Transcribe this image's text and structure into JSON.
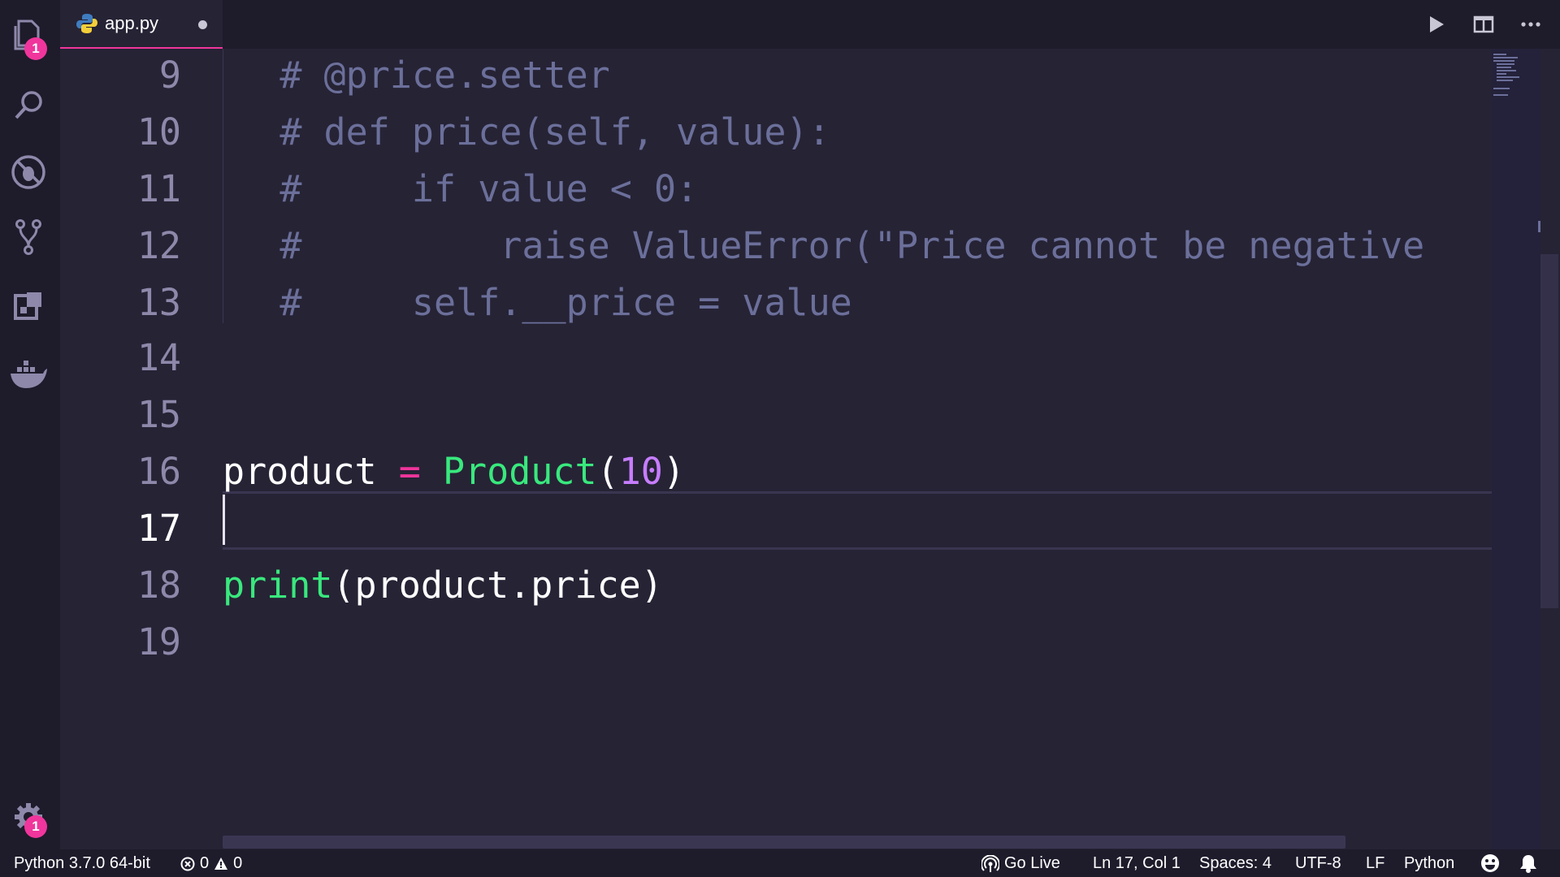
{
  "tab": {
    "title": "app.py",
    "unsaved": true
  },
  "activity_bar": {
    "explorer_badge": "1",
    "settings_badge": "1"
  },
  "editor": {
    "current_line": 17,
    "lines": [
      {
        "num": "9",
        "code_comment": "    # @price.setter"
      },
      {
        "num": "10",
        "code_comment": "    # def price(self, value):"
      },
      {
        "num": "11",
        "code_comment": "    #     if value < 0:"
      },
      {
        "num": "12",
        "code_comment": "    #         raise ValueError(\"Price cannot be negative"
      },
      {
        "num": "13",
        "code_comment": "    #     self.__price = value"
      },
      {
        "num": "14"
      },
      {
        "num": "15"
      },
      {
        "num": "16",
        "tokens": {
          "var": "product",
          "op": " = ",
          "cls": "Product",
          "open": "(",
          "num": "10",
          "close": ")"
        }
      },
      {
        "num": "17"
      },
      {
        "num": "18",
        "tokens": {
          "fn": "print",
          "rest": "(product.price)"
        }
      },
      {
        "num": "19"
      }
    ]
  },
  "status_bar": {
    "interpreter": "Python 3.7.0 64-bit",
    "errors": "0",
    "warnings": "0",
    "go_live": "Go Live",
    "position": "Ln 17, Col 1",
    "spaces": "Spaces: 4",
    "encoding": "UTF-8",
    "eol": "LF",
    "language": "Python"
  },
  "colors": {
    "background": "#262335",
    "accent": "#f0359c",
    "comment": "#6b6f9a",
    "class": "#39e87d",
    "number": "#c77dff"
  },
  "icons": [
    "files-icon",
    "search-icon",
    "debug-icon",
    "source-control-icon",
    "extensions-icon",
    "docker-icon",
    "gear-icon",
    "run-icon",
    "split-editor-icon",
    "more-icon",
    "error-icon",
    "warning-icon",
    "broadcast-icon",
    "feedback-icon",
    "bell-icon",
    "python-file-icon"
  ]
}
